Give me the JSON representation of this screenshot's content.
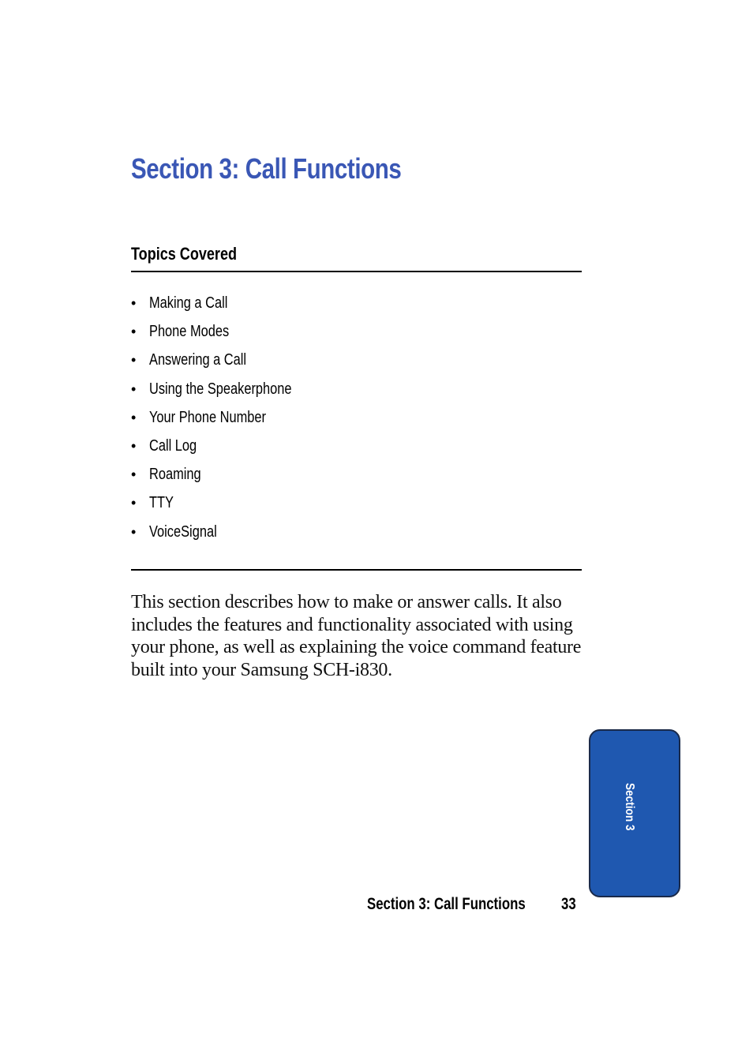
{
  "page": {
    "section_title": "Section 3: Call Functions",
    "topics_heading": "Topics Covered",
    "bullet_glyph": "•",
    "topics": [
      "Making a Call",
      "Phone Modes",
      "Answering a Call",
      "Using the Speakerphone",
      "Your Phone Number",
      "Call Log",
      "Roaming",
      "TTY",
      "VoiceSignal"
    ],
    "body_paragraph": "This section describes how to make or answer calls. It also includes the features and functionality associated with using your phone, as well as explaining the voice command feature built into your Samsung SCH-i830."
  },
  "side_tab": {
    "label": "Section 3",
    "color": "#1f58b0"
  },
  "footer": {
    "running_title": "Section 3: Call Functions",
    "page_number": "33"
  },
  "colors": {
    "title": "#3a57b5",
    "text": "#000000"
  }
}
